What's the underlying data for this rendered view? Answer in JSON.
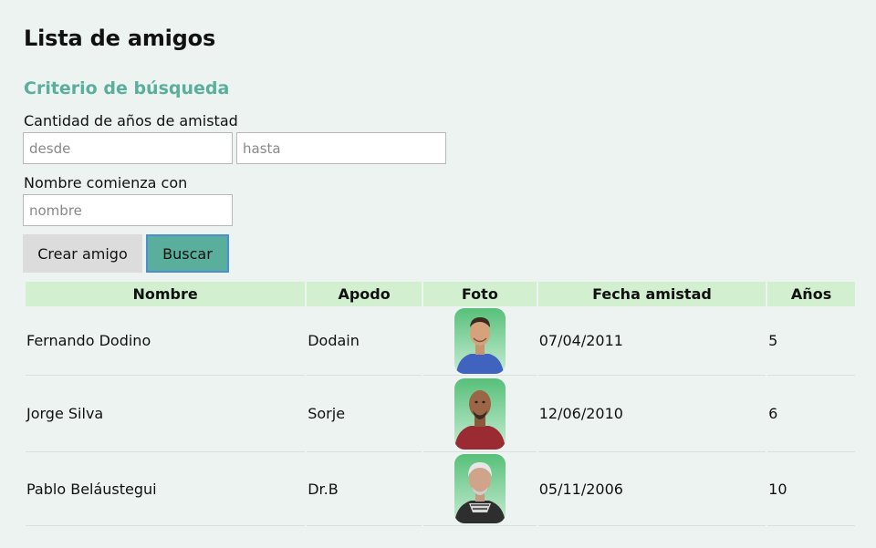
{
  "page": {
    "title": "Lista de amigos",
    "subtitle": "Criterio de búsqueda"
  },
  "filters": {
    "years_label": "Cantidad de años de amistad",
    "from_placeholder": "desde",
    "to_placeholder": "hasta",
    "name_label": "Nombre comienza con",
    "name_placeholder": "nombre"
  },
  "buttons": {
    "create": "Crear amigo",
    "search": "Buscar"
  },
  "table": {
    "headers": [
      "Nombre",
      "Apodo",
      "Foto",
      "Fecha amistad",
      "Años"
    ],
    "rows": [
      {
        "name": "Fernando Dodino",
        "nickname": "Dodain",
        "photo_icon": "person-photo",
        "date": "07/04/2011",
        "years": "5"
      },
      {
        "name": "Jorge Silva",
        "nickname": "Sorje",
        "photo_icon": "person-photo",
        "date": "12/06/2010",
        "years": "6"
      },
      {
        "name": "Pablo Beláustegui",
        "nickname": "Dr.B",
        "photo_icon": "person-photo",
        "date": "05/11/2006",
        "years": "10"
      }
    ]
  },
  "colors": {
    "background": "#ecf3f1",
    "accent": "#5aaf9c",
    "header_bg": "#d2efd0",
    "create_button_bg": "#dcdcdc",
    "focus_border": "#4a8fd6"
  }
}
